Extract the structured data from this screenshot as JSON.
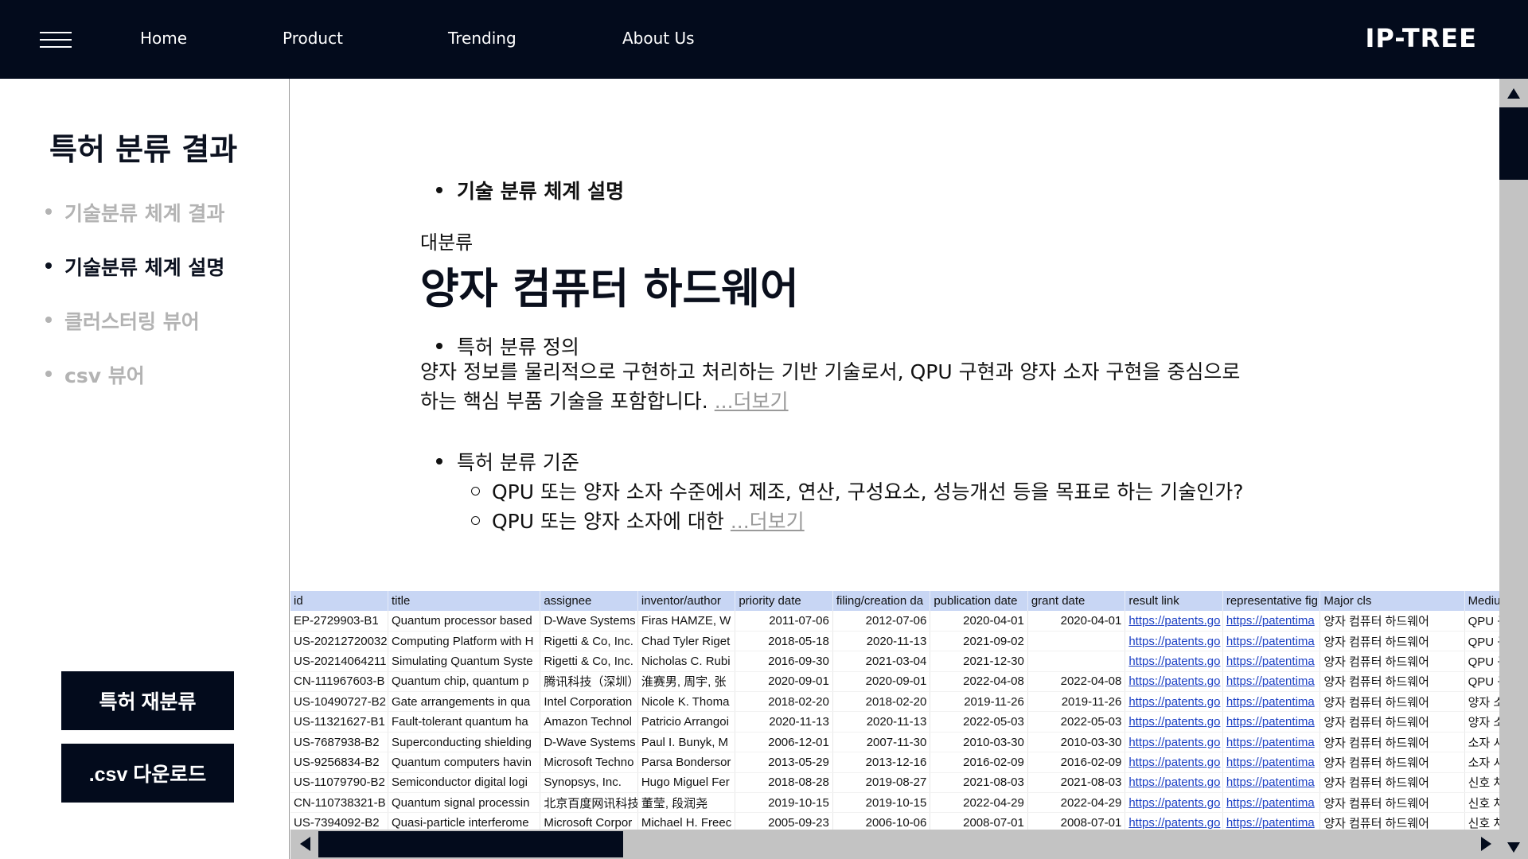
{
  "nav": {
    "links": [
      "Home",
      "Product",
      "Trending",
      "About Us"
    ],
    "brand": "IP-TREE"
  },
  "sidebar": {
    "title": "특허 분류 결과",
    "items": [
      {
        "label": "기술분류 체계 결과",
        "active": false
      },
      {
        "label": "기술분류 체계 설명",
        "active": true
      },
      {
        "label": "클러스터링 뷰어",
        "active": false
      },
      {
        "label": "csv 뷰어",
        "active": false
      }
    ],
    "buttons": {
      "reclassify": "특허 재분류",
      "download": ".csv 다운로드"
    }
  },
  "main": {
    "section_heading": "기술 분류 체계 설명",
    "category_label": "대분류",
    "category_title": "양자 컴퓨터 하드웨어",
    "definition_heading": "특허 분류 정의",
    "definition_text": "양자 정보를 물리적으로 구현하고 처리하는 기반 기술로서, QPU 구현과 양자 소자 구현을 중심으로 하는 핵심 부품 기술을 포함합니다.",
    "more_label": "...더보기",
    "criteria_heading": "특허 분류 기준",
    "criteria": [
      "QPU 또는 양자 소자 수준에서 제조, 연산, 구성요소, 성능개선 등을 목표로 하는 기술인가?",
      "QPU 또는 양자 소자에 대한"
    ]
  },
  "table": {
    "columns": [
      "id",
      "title",
      "assignee",
      "inventor/author",
      "priority date",
      "filing/creation da",
      "publication date",
      "grant date",
      "result link",
      "representative fig",
      "Major cls",
      "Medium"
    ],
    "rows": [
      [
        "EP-2729903-B1",
        "Quantum processor based",
        "D-Wave Systems",
        "Firas HAMZE, W",
        "2011-07-06",
        "2012-07-06",
        "2020-04-01",
        "2020-04-01",
        "https://patents.go",
        "https://patentima",
        "양자 컴퓨터 하드웨어",
        "QPU 구"
      ],
      [
        "US-20212720032",
        "Computing Platform with H",
        "Rigetti & Co, Inc.",
        "Chad Tyler Riget",
        "2018-05-18",
        "2020-11-13",
        "2021-09-02",
        "",
        "https://patents.go",
        "https://patentima",
        "양자 컴퓨터 하드웨어",
        "QPU 구"
      ],
      [
        "US-20214064211",
        "Simulating Quantum Syste",
        "Rigetti & Co, Inc.",
        "Nicholas C. Rubi",
        "2016-09-30",
        "2021-03-04",
        "2021-12-30",
        "",
        "https://patents.go",
        "https://patentima",
        "양자 컴퓨터 하드웨어",
        "QPU 구"
      ],
      [
        "CN-111967603-B",
        "Quantum chip, quantum p",
        "腾讯科技（深圳）",
        "淮赛男, 周宇, 张",
        "2020-09-01",
        "2020-09-01",
        "2022-04-08",
        "2022-04-08",
        "https://patents.go",
        "https://patentima",
        "양자 컴퓨터 하드웨어",
        "QPU 구"
      ],
      [
        "US-10490727-B2",
        "Gate arrangements in qua",
        "Intel Corporation",
        "Nicole K. Thoma",
        "2018-02-20",
        "2018-02-20",
        "2019-11-26",
        "2019-11-26",
        "https://patents.go",
        "https://patentima",
        "양자 컴퓨터 하드웨어",
        "양자 소"
      ],
      [
        "US-11321627-B1",
        "Fault-tolerant quantum ha",
        "Amazon Technol",
        "Patricio Arrangoi",
        "2020-11-13",
        "2020-11-13",
        "2022-05-03",
        "2022-05-03",
        "https://patents.go",
        "https://patentima",
        "양자 컴퓨터 하드웨어",
        "양자 소"
      ],
      [
        "US-7687938-B2",
        "Superconducting shielding",
        "D-Wave Systems",
        "Paul I. Bunyk, M",
        "2006-12-01",
        "2007-11-30",
        "2010-03-30",
        "2010-03-30",
        "https://patents.go",
        "https://patentima",
        "양자 컴퓨터 하드웨어",
        "소자 시"
      ],
      [
        "US-9256834-B2",
        "Quantum computers havin",
        "Microsoft Techno",
        "Parsa Bondersor",
        "2013-05-29",
        "2013-12-16",
        "2016-02-09",
        "2016-02-09",
        "https://patents.go",
        "https://patentima",
        "양자 컴퓨터 하드웨어",
        "소자 시"
      ],
      [
        "US-11079790-B2",
        "Semiconductor digital logi",
        "Synopsys, Inc.",
        "Hugo Miguel Fer",
        "2018-08-28",
        "2019-08-27",
        "2021-08-03",
        "2021-08-03",
        "https://patents.go",
        "https://patentima",
        "양자 컴퓨터 하드웨어",
        "신호 처"
      ],
      [
        "CN-110738321-B",
        "Quantum signal processin",
        "北京百度网讯科技",
        "董莹, 段润尧",
        "2019-10-15",
        "2019-10-15",
        "2022-04-29",
        "2022-04-29",
        "https://patents.go",
        "https://patentima",
        "양자 컴퓨터 하드웨어",
        "신호 처"
      ],
      [
        "US-7394092-B2",
        "Quasi-particle interferome",
        "Microsoft Corpor",
        "Michael H. Freec",
        "2005-09-23",
        "2006-10-06",
        "2008-07-01",
        "2008-07-01",
        "https://patents.go",
        "https://patentima",
        "양자 컴퓨터 하드웨어",
        "신호 처"
      ]
    ]
  }
}
